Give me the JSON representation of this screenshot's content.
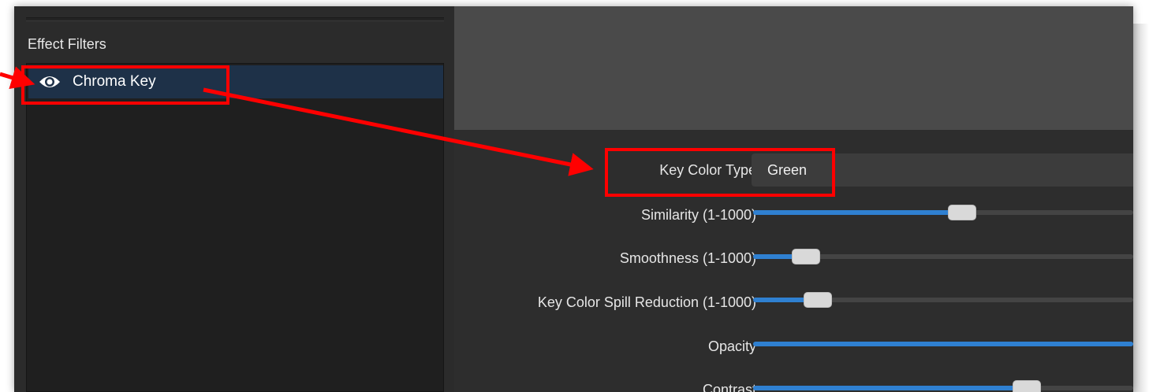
{
  "effect_filters": {
    "title": "Effect Filters",
    "items": [
      {
        "label": "Chroma Key",
        "visible": true,
        "selected": true
      }
    ]
  },
  "properties": {
    "key_color_type": {
      "label": "Key Color Type",
      "value": "Green"
    },
    "sliders": [
      {
        "label": "Similarity (1-1000)",
        "level_percent": 55
      },
      {
        "label": "Smoothness (1-1000)",
        "level_percent": 14
      },
      {
        "label": "Key Color Spill Reduction (1-1000)",
        "level_percent": 17
      },
      {
        "label": "Opacity",
        "level_percent": 100
      },
      {
        "label": "Contrast",
        "level_percent": 72
      }
    ]
  },
  "annotations": {
    "color": "#ff0000"
  },
  "colors": {
    "selection": "#1e3148",
    "slider_fill": "#2f80d1",
    "handle": "#d9d9d9"
  }
}
